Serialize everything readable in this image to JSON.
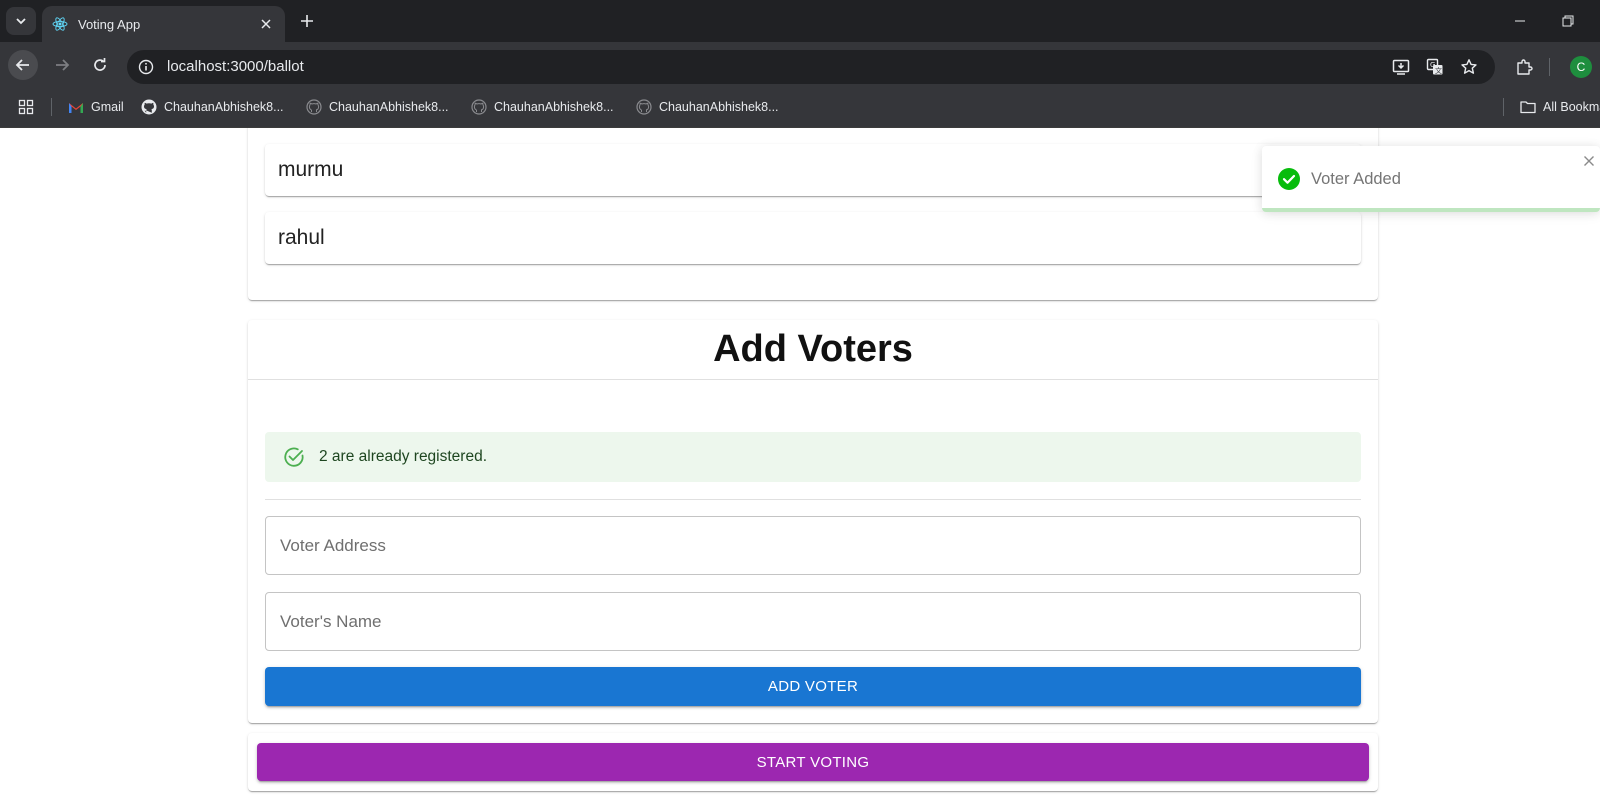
{
  "browser": {
    "tab_title": "Voting App",
    "url": "localhost:3000/ballot",
    "profile_initial": "C",
    "bookmarks": [
      "Gmail",
      "ChauhanAbhishek8...",
      "ChauhanAbhishek8...",
      "ChauhanAbhishek8...",
      "ChauhanAbhishek8..."
    ],
    "all_bookmarks_label": "All Bookmarks"
  },
  "candidates": [
    "murmu",
    "rahul"
  ],
  "add_voters": {
    "title": "Add Voters",
    "alert_text": "2 are already registered.",
    "address_placeholder": "Voter Address",
    "name_placeholder": "Voter's Name",
    "add_button": "ADD VOTER"
  },
  "start_voting_button": "START VOTING",
  "toast": {
    "message": "Voter Added",
    "progress_fraction": 1.0
  },
  "colors": {
    "primary": "#1976d2",
    "secondary": "#9c27b0",
    "success": "#07bc0c",
    "alert_bg": "#edf7ed"
  }
}
